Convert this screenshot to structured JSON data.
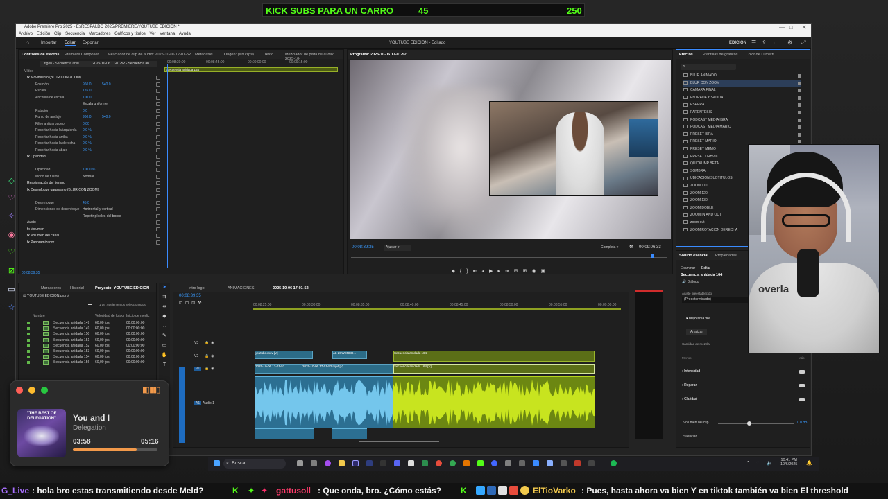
{
  "kick_banner": {
    "title": "KICK SUBS PARA UN CARRO",
    "current": "45",
    "goal": "250"
  },
  "premiere": {
    "window_title": "Adobe Premiere Pro 2025 - E:\\RESPALDO 2025\\PREMIERE\\YOUTUBE EDICION *",
    "menu": [
      "Archivo",
      "Edición",
      "Clip",
      "Secuencia",
      "Marcadores",
      "Gráficos y títulos",
      "Ver",
      "Ventana",
      "Ayuda"
    ],
    "workspace_tabs": [
      "Importar",
      "Editar",
      "Exportar"
    ],
    "center_title": "YOUTUBE EDICION - Editado",
    "workspace_name": "EDICIÓN",
    "effect_controls": {
      "tabs": [
        "Controles de efectos",
        "Premiere Composer",
        "Mezclador de clip de audio: 2025-10-06 17-01-52",
        "Metadatos",
        "Origen: (sin clips)",
        "Texto",
        "Mezclador de pista de audio: 2025-10-"
      ],
      "source_label": "Origen - Secuencia anid...",
      "sequence_label": "2025-10-06 17-01-52 - Secuencia an...",
      "mini_clip": "Secuencia anidada 164",
      "ruler": [
        "00:08:30:00",
        "00:08:45:00",
        "00:09:00:00",
        "00:09:15:00",
        "00:09:30:00"
      ],
      "section_video": "Vídeo",
      "rows": [
        {
          "label": "fx Movimiento (BLUR CON ZOOM)",
          "value": ""
        },
        {
          "label": "Posición",
          "value": "960.0",
          "value2": "540.0"
        },
        {
          "label": "Escala",
          "value": "176.0",
          "value2": ""
        },
        {
          "label": "Anchura de escala",
          "value": "100.0",
          "value2": ""
        },
        {
          "label": "",
          "value": "Escala uniforme",
          "value2": ""
        },
        {
          "label": "Rotación",
          "value": "0.0",
          "value2": ""
        },
        {
          "label": "Punto de anclaje",
          "value": "960.0",
          "value2": "540.0"
        },
        {
          "label": "Filtro antiparpadeo",
          "value": "0.00",
          "value2": ""
        },
        {
          "label": "Recortar hacia la izquierda",
          "value": "0.0 %",
          "value2": ""
        },
        {
          "label": "Recortar hacia arriba",
          "value": "0.0 %",
          "value2": ""
        },
        {
          "label": "Recortar hacia la derecha",
          "value": "0.0 %",
          "value2": ""
        },
        {
          "label": "Recortar hacia abajo",
          "value": "0.0 %",
          "value2": ""
        },
        {
          "label": "fx Opacidad",
          "value": "",
          "value2": ""
        },
        {
          "label": "",
          "value": "",
          "value2": ""
        },
        {
          "label": "Opacidad",
          "value": "100.0 %",
          "value2": ""
        },
        {
          "label": "Modo de fusión",
          "value": "Normal",
          "value2": ""
        },
        {
          "label": "Reasignación del tiempo",
          "value": "",
          "value2": ""
        },
        {
          "label": "fx Desenfoque gaussiano (BLUR CON ZOOM)",
          "value": "",
          "value2": ""
        },
        {
          "label": "",
          "value": "",
          "value2": ""
        },
        {
          "label": "Desenfoque",
          "value": "45.0",
          "value2": ""
        },
        {
          "label": "Dimensiones de desenfoque",
          "value": "Horizontal y vertical",
          "value2": ""
        },
        {
          "label": "",
          "value": "Repetir píxeles del borde",
          "value2": ""
        },
        {
          "label": "Audio",
          "value": "",
          "value2": ""
        },
        {
          "label": "fx Volumen",
          "value": "",
          "value2": ""
        },
        {
          "label": "fx Volumen del canal",
          "value": "",
          "value2": ""
        },
        {
          "label": "fx Panoramizador",
          "value": "",
          "value2": ""
        }
      ],
      "timecode": "00:08:39:35"
    },
    "program": {
      "title": "Programa: 2025-10-06 17-01-52",
      "timecode": "00:08:39:35",
      "fit": "Ajustar",
      "quality": "Completa",
      "duration": "00:09:06:33"
    },
    "effects": {
      "tabs": [
        "Efectos",
        "Plantillas de gráficos",
        "Color de Lumetri"
      ],
      "items": [
        "BLUR ANIMADO",
        "BLUR CON ZOOM",
        "CAMARA FINAL",
        "ENTRADA Y SALIDA",
        "ESPERA",
        "PARENTESIS",
        "PODCAST MEDIA ISRA",
        "PODCAST MEDIA MARIO",
        "PRESET ISRA",
        "PRESET MARIO",
        "PRESET MEMO",
        "PRESET URBVIC",
        "QUICKUMP BETA",
        "SOMBRA",
        "UBICACION SUBTITULOS",
        "ZOOM 110",
        "ZOOM 120",
        "ZOOM 130",
        "ZOOM DOBLE",
        "ZOOM IN AND OUT",
        "zoom out",
        "ZOOM ROTACION DERECHA"
      ]
    },
    "essential_sound": {
      "tabs": [
        "Sonido esencial",
        "Propiedades"
      ],
      "subtabs": [
        "Examinar",
        "Editar"
      ],
      "title": "Secuencia anidada 164",
      "type": "Diálogo",
      "preset_label": "Ajuste preestablecido:",
      "preset_value": "(Predeterminado)",
      "enhance": "Mejorar la voz",
      "analyze": "Analizar",
      "mix_label": "Cantidad de mezcla:",
      "less": "Menos",
      "more": "Más",
      "sections": [
        "Intensidad",
        "Reparar",
        "Claridad"
      ],
      "clip_volume": "Volumen del clip",
      "clip_volume_value": "0.0 dB",
      "mute": "Silenciar"
    },
    "project": {
      "tabs": [
        "Marcadores",
        "Historial",
        "Proyecto: YOUTUBE EDICION"
      ],
      "file": "YOUTUBE EDICION.prproj",
      "count": "1 de 74 elementos seleccionados",
      "columns": [
        "Nombre",
        "Velocidad de fotogr",
        "Inicio de medic"
      ],
      "rows": [
        {
          "name": "Secuencia anidada 149",
          "fps": "60,00 fps",
          "start": "00:00:00:00"
        },
        {
          "name": "Secuencia anidada 149",
          "fps": "60,00 fps",
          "start": "00:00:00:00"
        },
        {
          "name": "Secuencia anidada 150",
          "fps": "60,00 fps",
          "start": "00:00:00:00"
        },
        {
          "name": "Secuencia anidada 151",
          "fps": "60,00 fps",
          "start": "00:00:00:00"
        },
        {
          "name": "Secuencia anidada 152",
          "fps": "60,00 fps",
          "start": "00:00:00:00"
        },
        {
          "name": "Secuencia anidada 153",
          "fps": "60,00 fps",
          "start": "00:00:00:00"
        },
        {
          "name": "Secuencia anidada 154",
          "fps": "60,00 fps",
          "start": "00:00:00:00"
        },
        {
          "name": "Secuencia anidada 156",
          "fps": "60,00 fps",
          "start": "00:00:00:00"
        }
      ]
    },
    "timeline": {
      "tabs": [
        "intro logo",
        "ANIMACIONES",
        "2025-10-06 17-01-52"
      ],
      "timecode": "00:08:39:35",
      "ruler": [
        "00:08:25:00",
        "00:08:30:00",
        "00:08:35:00",
        "00:08:40:00",
        "00:08:45:00",
        "00:08:50:00",
        "00:08:55:00",
        "00:09:00:00"
      ],
      "track_labels": [
        "V3",
        "V2",
        "V1",
        "A1"
      ],
      "audio_track_name": "Audio 1",
      "clips": {
        "v2_a": "youtube.mov [V]",
        "v2_b": "AL LOWERED...",
        "v2_c": "Secuencia anidada 164",
        "v1_a": "2025-10-06 17-01-52...",
        "v1_b": "2025-10-06 17-01-52.mp4 [V]",
        "v1_c": "Secuencia anidada 164 [V]"
      }
    }
  },
  "music_widget": {
    "album_text": "\"THE BEST OF DELEGATION\"",
    "title": "You and I",
    "artist": "Delegation",
    "elapsed": "03:58",
    "total": "05:16",
    "progress": 0.755
  },
  "taskbar": {
    "search": "Buscar",
    "time": "10:41 PM",
    "date": "10/6/2025"
  },
  "webcam_overlay_text": "overla",
  "chat": {
    "m1_user": "G_Live",
    "m1_text": ": hola bro  estas transmitiendo desde Meld?",
    "m2_user": "gattusoll",
    "m2_text": ": Que onda, bro. ¿Cómo estás?",
    "m3_user": "ElTioVarko",
    "m3_text": ": Pues, hasta ahora va bien  Y en tiktok también va bien  El threshold"
  },
  "colors": {
    "kick_green": "#53fc18",
    "accent_blue": "#3a8bff",
    "clip_blue": "#4aa7d8",
    "clip_green": "#b5d21d"
  }
}
